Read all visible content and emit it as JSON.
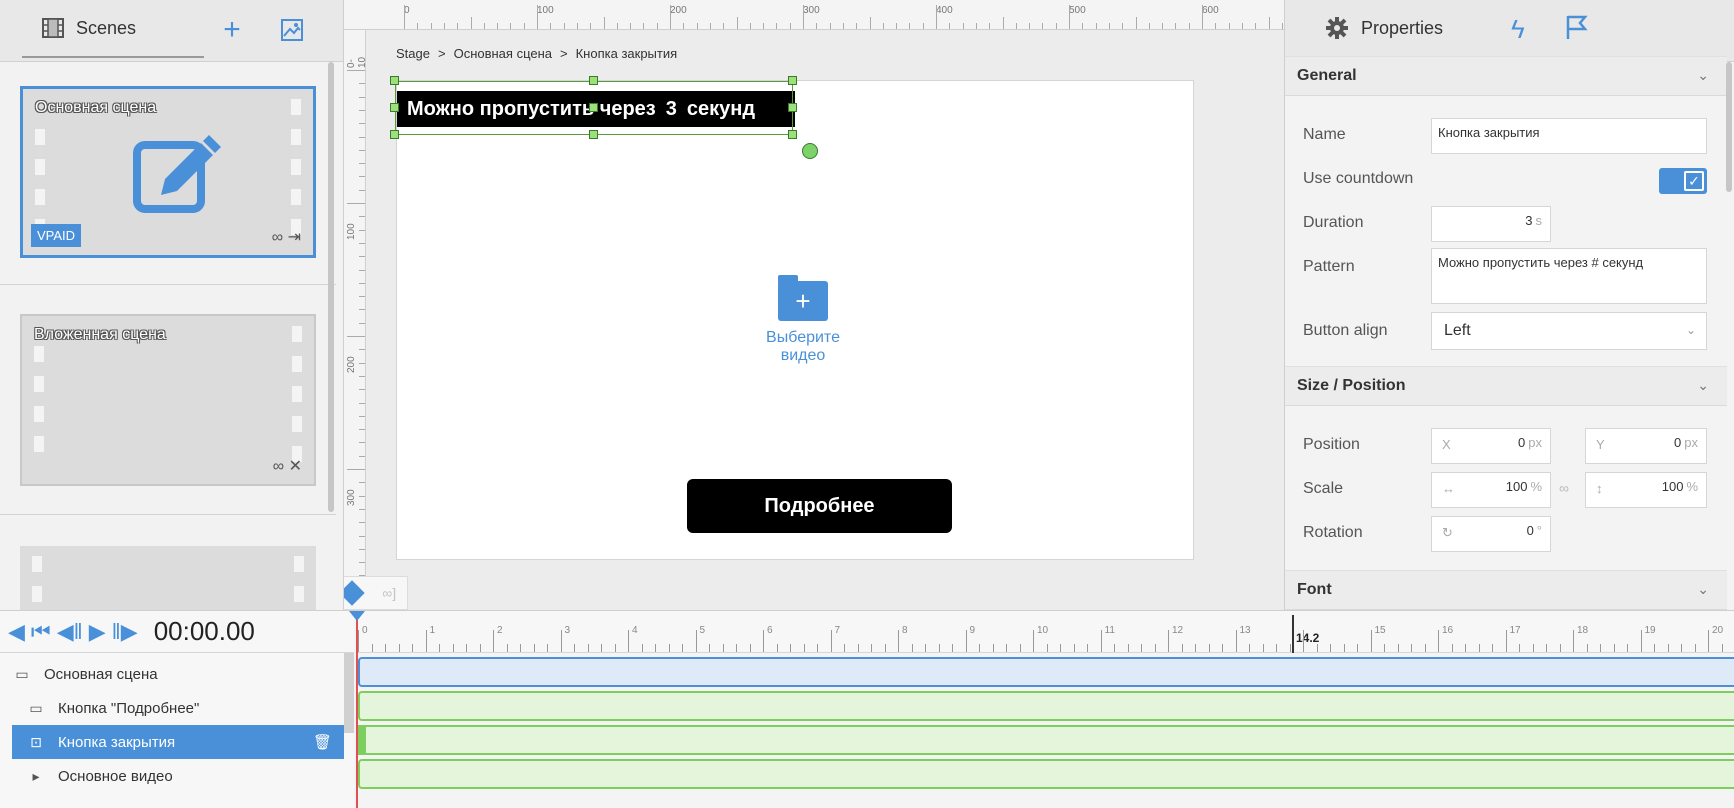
{
  "scenes_panel": {
    "tab_label": "Scenes",
    "add_label": "+",
    "items": [
      {
        "name": "Основная сцена",
        "badge": "VPAID",
        "icons": "∞ ⇥"
      },
      {
        "name": "Вложенная сцена",
        "icons": "∞ ✕"
      }
    ]
  },
  "canvas": {
    "ruler_top": [
      "0",
      "100",
      "200",
      "300",
      "400",
      "500",
      "600"
    ],
    "ruler_left": [
      "0-10",
      "100",
      "200",
      "300"
    ],
    "breadcrumb": [
      "Stage",
      ">",
      "Основная сцена",
      ">",
      "Кнопка закрытия"
    ],
    "close_button_text": {
      "before": "Можно пропустить через",
      "count": "3",
      "after": "секунд"
    },
    "video_placeholder": "Выберите видео",
    "more_button": "Подробнее"
  },
  "properties": {
    "tab_label": "Properties",
    "sections": {
      "general": "General",
      "size_position": "Size / Position",
      "font": "Font"
    },
    "fields": {
      "name_label": "Name",
      "name_value": "Кнопка закрытия",
      "use_countdown_label": "Use countdown",
      "use_countdown_value": true,
      "duration_label": "Duration",
      "duration_value": "3",
      "duration_unit": "s",
      "pattern_label": "Pattern",
      "pattern_value": "Можно пропустить через # секунд",
      "button_align_label": "Button align",
      "button_align_value": "Left",
      "position_label": "Position",
      "pos_x_prefix": "X",
      "pos_x_value": "0",
      "pos_y_prefix": "Y",
      "pos_y_value": "0",
      "px_unit": "px",
      "scale_label": "Scale",
      "scale_x_value": "100",
      "scale_y_value": "100",
      "pct_unit": "%",
      "rotation_label": "Rotation",
      "rotation_value": "0",
      "deg_unit": "°"
    }
  },
  "timeline": {
    "timecode": "00:00.00",
    "end_marker": "14.2",
    "ruler_numbers": [
      "0",
      "1",
      "2",
      "3",
      "4",
      "5",
      "6",
      "7",
      "8",
      "9",
      "10",
      "11",
      "12",
      "13",
      "15",
      "16",
      "17",
      "18",
      "19",
      "20"
    ],
    "layers": [
      {
        "label": "Основная сцена",
        "icon": "scene-icon"
      },
      {
        "label": "Кнопка \"Подробнее\"",
        "icon": "button-icon"
      },
      {
        "label": "Кнопка закрытия",
        "icon": "close-button-icon",
        "selected": true
      },
      {
        "label": "Основное видео",
        "icon": "video-icon"
      }
    ],
    "colors": {
      "scene_track": "#4a90d9",
      "layer_track": "#7ccf5c",
      "playhead": "#e05050"
    }
  }
}
